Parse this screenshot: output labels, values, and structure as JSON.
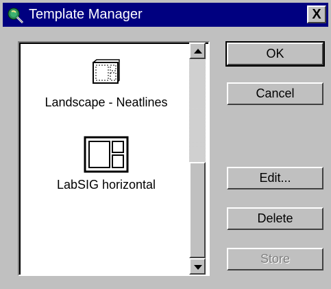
{
  "window": {
    "title": "Template Manager",
    "title_icon": "globe-magnifier-icon",
    "close_label": "X"
  },
  "templates": [
    {
      "label": "Landscape - Neatlines",
      "icon": "landscape-template-icon",
      "selected": false
    },
    {
      "label": "LabSIG horizontal",
      "icon": "horizontal-template-icon",
      "selected": false
    }
  ],
  "buttons": {
    "ok": "OK",
    "cancel": "Cancel",
    "edit": "Edit...",
    "delete": "Delete",
    "store": "Store"
  },
  "colors": {
    "titlebar": "#000080",
    "face": "#c0c0c0",
    "disabled_text": "#808080"
  }
}
